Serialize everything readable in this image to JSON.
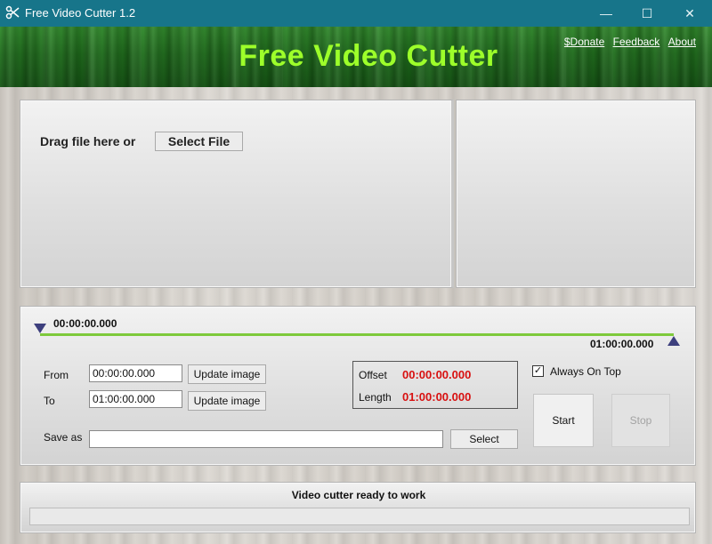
{
  "window": {
    "title": "Free Video Cutter 1.2",
    "minimize_glyph": "—",
    "maximize_glyph": "☐",
    "close_glyph": "✕"
  },
  "header": {
    "app_title": "Free Video Cutter",
    "links": {
      "donate": "$Donate",
      "feedback": "Feedback",
      "about": "About"
    }
  },
  "drop_area": {
    "prompt": "Drag file here or",
    "select_file_label": "Select File"
  },
  "timeline": {
    "start_time": "00:00:00.000",
    "end_time": "01:00:00.000"
  },
  "range": {
    "from_label": "From",
    "from_value": "00:00:00.000",
    "to_label": "To",
    "to_value": "01:00:00.000",
    "update_image_label": "Update image"
  },
  "info": {
    "offset_label": "Offset",
    "offset_value": "00:00:00.000",
    "length_label": "Length",
    "length_value": "01:00:00.000"
  },
  "options": {
    "always_on_top_label": "Always On Top",
    "always_on_top_checked": true
  },
  "save": {
    "label": "Save as",
    "value": "",
    "select_label": "Select"
  },
  "actions": {
    "start_label": "Start",
    "stop_label": "Stop"
  },
  "status": {
    "message": "Video cutter ready to work",
    "progress": 0
  },
  "colors": {
    "titlebar": "#17758a",
    "app_title": "#9dff2a",
    "timeline_line": "#7ec93b",
    "marker": "#3d3f7d",
    "value_red": "#d81010"
  }
}
